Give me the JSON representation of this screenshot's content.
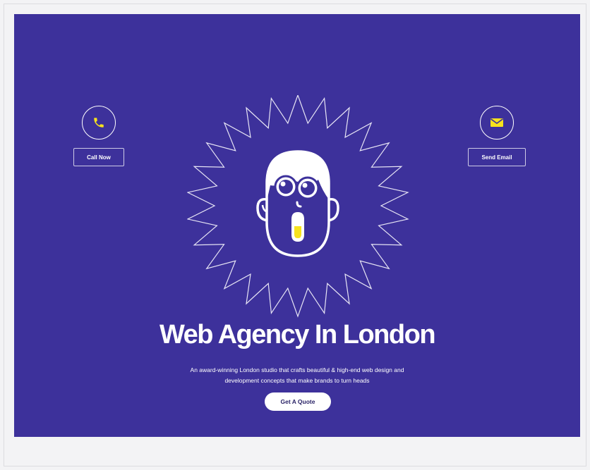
{
  "colors": {
    "hero_background": "#3d319b",
    "accent_yellow": "#f7e21d",
    "page_background": "#f3f3f5"
  },
  "hero": {
    "title": "Web Agency In London",
    "subtitle_line1": "An award-winning London studio that crafts beautiful & high-end web design and",
    "subtitle_line2": "development concepts that make brands to turn heads",
    "cta_label": "Get A Quote"
  },
  "contacts": {
    "call_label": "Call Now",
    "call_icon": "phone-icon",
    "email_label": "Send Email",
    "email_icon": "mail-icon"
  },
  "illustration": {
    "icon": "surprised-face-mascot"
  }
}
